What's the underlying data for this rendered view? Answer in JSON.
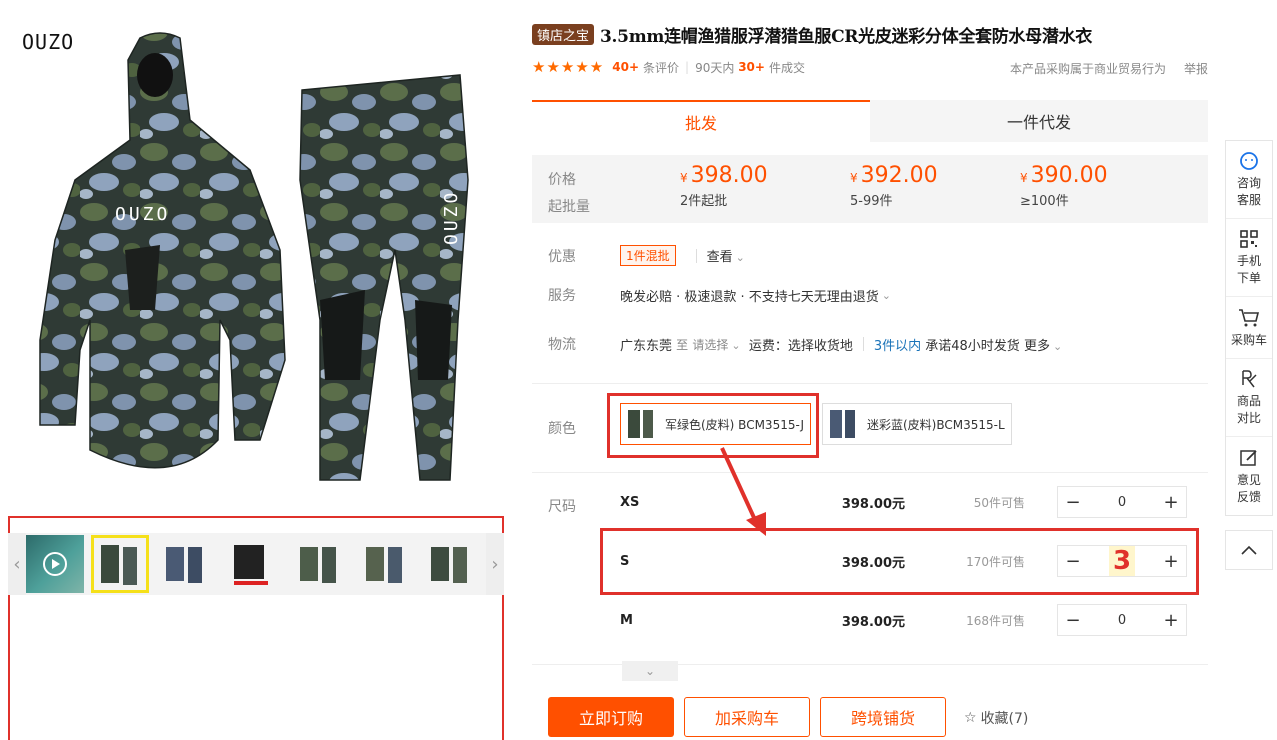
{
  "brand_logo": "OUZO",
  "gallery": {
    "thumb_count_label": "",
    "left_arrow": "‹",
    "right_arrow": "›"
  },
  "product": {
    "shop_badge": "镇店之宝",
    "title": "3.5mm连帽渔猎服浮潜猎鱼服CR光皮迷彩分体全套防水母潜水衣",
    "stars": "★★★★★",
    "review_count": "40+",
    "review_label": "条评价",
    "sales_period": "90天内",
    "sales_count": "30+",
    "sales_label": "件成交",
    "trade_note": "本产品采购属于商业贸易行为",
    "report_link": "举报"
  },
  "tabs": [
    {
      "label": "批发",
      "active": true
    },
    {
      "label": "一件代发",
      "active": false
    }
  ],
  "pricing": {
    "price_label": "价格",
    "moq_label": "起批量",
    "currency": "¥",
    "tiers": [
      {
        "price": "398.00",
        "qty": "2件起批"
      },
      {
        "price": "392.00",
        "qty": "5-99件"
      },
      {
        "price": "390.00",
        "qty": "≥100件"
      }
    ]
  },
  "promo": {
    "label": "优惠",
    "tag": "1件混批",
    "view": "查看"
  },
  "service": {
    "label": "服务",
    "text": "晚发必赔 · 极速退款 · 不支持七天无理由退货"
  },
  "logistics": {
    "label": "物流",
    "origin": "广东东莞",
    "to": "至",
    "select": "请选择",
    "freight": "运费：选择收货地",
    "promise_qty": "3件以内",
    "promise_text": "承诺48小时发货",
    "more": "更多"
  },
  "color": {
    "label": "颜色",
    "options": [
      {
        "name": "军绿色(皮料) BCM3515-J",
        "selected": true
      },
      {
        "name": "迷彩蓝(皮料)BCM3515-L",
        "selected": false
      }
    ]
  },
  "size": {
    "label": "尺码",
    "rows": [
      {
        "name": "XS",
        "price": "398.00元",
        "stock": "50件可售",
        "qty": "0"
      },
      {
        "name": "S",
        "price": "398.00元",
        "stock": "170件可售",
        "qty": "3"
      },
      {
        "name": "M",
        "price": "398.00元",
        "stock": "168件可售",
        "qty": "0"
      }
    ],
    "minus": "−",
    "plus": "+"
  },
  "actions": {
    "buy_now": "立即订购",
    "add_cart": "加采购车",
    "cross_border": "跨境铺货",
    "favorite": "收藏(7)"
  },
  "side_bar": {
    "items": [
      "咨询\n客服",
      "手机\n下单",
      "采购车",
      "商品\n对比",
      "意见\n反馈"
    ]
  },
  "colors": {
    "accent": "#ff5000",
    "annotation": "#e0312b",
    "badge": "#7a3f1f"
  }
}
